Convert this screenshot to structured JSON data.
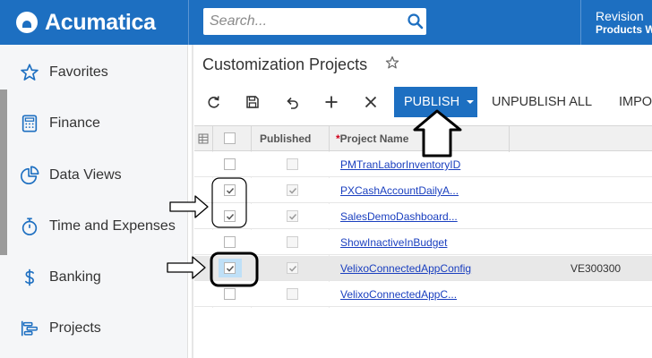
{
  "app": {
    "name": "Acumatica"
  },
  "search": {
    "placeholder": "Search..."
  },
  "company": {
    "line1": "Revision",
    "line2": "Products W"
  },
  "sidebar": {
    "items": [
      {
        "label": "Favorites",
        "icon": "star-icon"
      },
      {
        "label": "Finance",
        "icon": "calculator-icon"
      },
      {
        "label": "Data Views",
        "icon": "pie-chart-icon"
      },
      {
        "label": "Time and Expenses",
        "icon": "stopwatch-icon"
      },
      {
        "label": "Banking",
        "icon": "dollar-icon"
      },
      {
        "label": "Projects",
        "icon": "gantt-icon"
      }
    ]
  },
  "page": {
    "title": "Customization Projects"
  },
  "toolbar": {
    "icons": [
      "refresh-icon",
      "save-icon",
      "undo-icon",
      "add-icon",
      "delete-icon"
    ],
    "publish_label": "PUBLISH",
    "unpublish_label": "UNPUBLISH ALL",
    "import_label": "IMPO"
  },
  "grid": {
    "columns": {
      "published": "Published",
      "required_mark": "*",
      "project_name": "Project Name"
    },
    "rows": [
      {
        "selected": false,
        "published": false,
        "name": "PMTranLaborInventoryID",
        "col4": ""
      },
      {
        "selected": true,
        "published": true,
        "name": "PXCashAccountDailyA...",
        "col4": ""
      },
      {
        "selected": true,
        "published": true,
        "name": "SalesDemoDashboard...",
        "col4": ""
      },
      {
        "selected": false,
        "published": false,
        "name": "ShowInactiveInBudget",
        "col4": ""
      },
      {
        "selected": true,
        "published": true,
        "name": "VelixoConnectedAppConfig",
        "col4": "VE300300",
        "current": true
      },
      {
        "selected": false,
        "published": false,
        "name": "VelixoConnectedAppC...",
        "col4": ""
      }
    ]
  },
  "colors": {
    "brand": "#1d6fc1",
    "link": "#1a3fbf",
    "sidebar_bg": "#f5f6f8"
  }
}
